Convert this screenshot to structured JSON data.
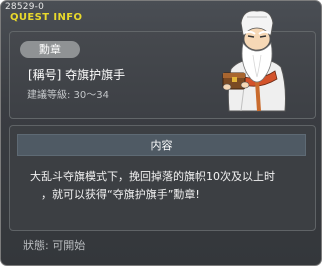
{
  "window": {
    "quest_id": "28529-0",
    "title": "QUEST INFO"
  },
  "summary": {
    "badge": "勳章",
    "name": "[稱号] 夺旗护旗手",
    "level": "建議等級: 30～34"
  },
  "content": {
    "header": "内容",
    "line1": "大乱斗夺旗模式下，挽回掉落的旗帜10次及以上时",
    "line2": "，就可以获得“夺旗护旗手”勳章!"
  },
  "status": "狀態: 可開始",
  "npc": {
    "icon": "bearded-sage-npc"
  }
}
